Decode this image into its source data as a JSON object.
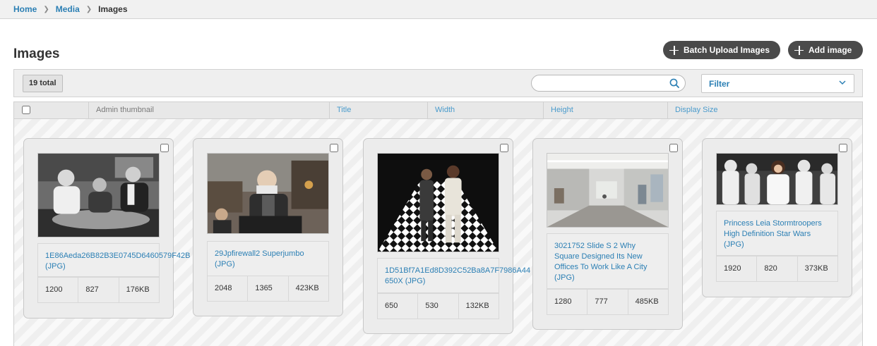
{
  "breadcrumb": {
    "home": "Home",
    "media": "Media",
    "current": "Images"
  },
  "page": {
    "title": "Images"
  },
  "actions": {
    "batch_upload": "Batch Upload Images",
    "add_image": "Add image"
  },
  "toolbar": {
    "total": "19 total",
    "search_placeholder": "",
    "filter_label": "Filter"
  },
  "columns": {
    "thumbnail": "Admin thumbnail",
    "title": "Title",
    "width": "Width",
    "height": "Height",
    "display_size": "Display Size"
  },
  "colors": {
    "link": "#2b7fb4",
    "pill": "#4a4a4a",
    "toolbar_bg": "#efefef"
  },
  "images": [
    {
      "title": "1E86Aeda26B82B3E0745D6460579F42B (JPG)",
      "width": "1200",
      "height": "827",
      "size": "176KB",
      "checked": false
    },
    {
      "title": "29Jpfirewall2 Superjumbo (JPG)",
      "width": "2048",
      "height": "1365",
      "size": "423KB",
      "checked": false
    },
    {
      "title": "1D51Bf7A1Ed8D392C52Ba8A7F7986A44 650X (JPG)",
      "width": "650",
      "height": "530",
      "size": "132KB",
      "checked": false
    },
    {
      "title": "3021752 Slide S 2 Why Square Designed Its New Offices To Work Like A City (JPG)",
      "width": "1280",
      "height": "777",
      "size": "485KB",
      "checked": false
    },
    {
      "title": "Princess Leia Stormtroopers High Definition Star Wars (JPG)",
      "width": "1920",
      "height": "820",
      "size": "373KB",
      "checked": false
    }
  ]
}
